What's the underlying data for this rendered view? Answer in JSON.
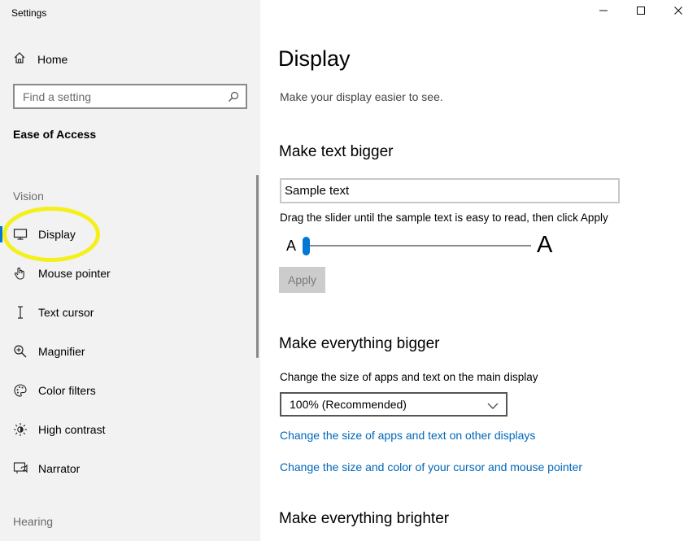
{
  "app": {
    "title": "Settings"
  },
  "window_controls": {
    "minimize": "minimize-icon",
    "maximize": "maximize-icon",
    "close": "close-icon"
  },
  "sidebar": {
    "home": {
      "label": "Home",
      "icon": "home-icon"
    },
    "search": {
      "placeholder": "Find a setting",
      "icon": "search-icon"
    },
    "category": "Ease of Access",
    "groups": {
      "vision": "Vision",
      "hearing": "Hearing"
    },
    "items": [
      {
        "label": "Display",
        "icon": "monitor-icon",
        "selected": true
      },
      {
        "label": "Mouse pointer",
        "icon": "mouse-pointer-icon"
      },
      {
        "label": "Text cursor",
        "icon": "text-cursor-icon"
      },
      {
        "label": "Magnifier",
        "icon": "magnifier-icon"
      },
      {
        "label": "Color filters",
        "icon": "palette-icon"
      },
      {
        "label": "High contrast",
        "icon": "contrast-icon"
      },
      {
        "label": "Narrator",
        "icon": "narrator-icon"
      }
    ]
  },
  "main": {
    "title": "Display",
    "subtitle": "Make your display easier to see.",
    "text_bigger": {
      "heading": "Make text bigger",
      "sample": "Sample text",
      "hint": "Drag the slider until the sample text is easy to read, then click Apply",
      "slider_min_label": "A",
      "slider_max_label": "A",
      "slider_value_fraction": 0.0,
      "apply_label": "Apply"
    },
    "everything_bigger": {
      "heading": "Make everything bigger",
      "label": "Change the size of apps and text on the main display",
      "selected": "100% (Recommended)",
      "link_other_displays": "Change the size of apps and text on other displays",
      "link_cursor": "Change the size and color of your cursor and mouse pointer"
    },
    "everything_brighter": {
      "heading": "Make everything brighter"
    }
  },
  "colors": {
    "accent": "#0078d4",
    "link": "#0067b8",
    "highlight": "#f3f01a",
    "sidebar_bg": "#f2f2f2"
  }
}
